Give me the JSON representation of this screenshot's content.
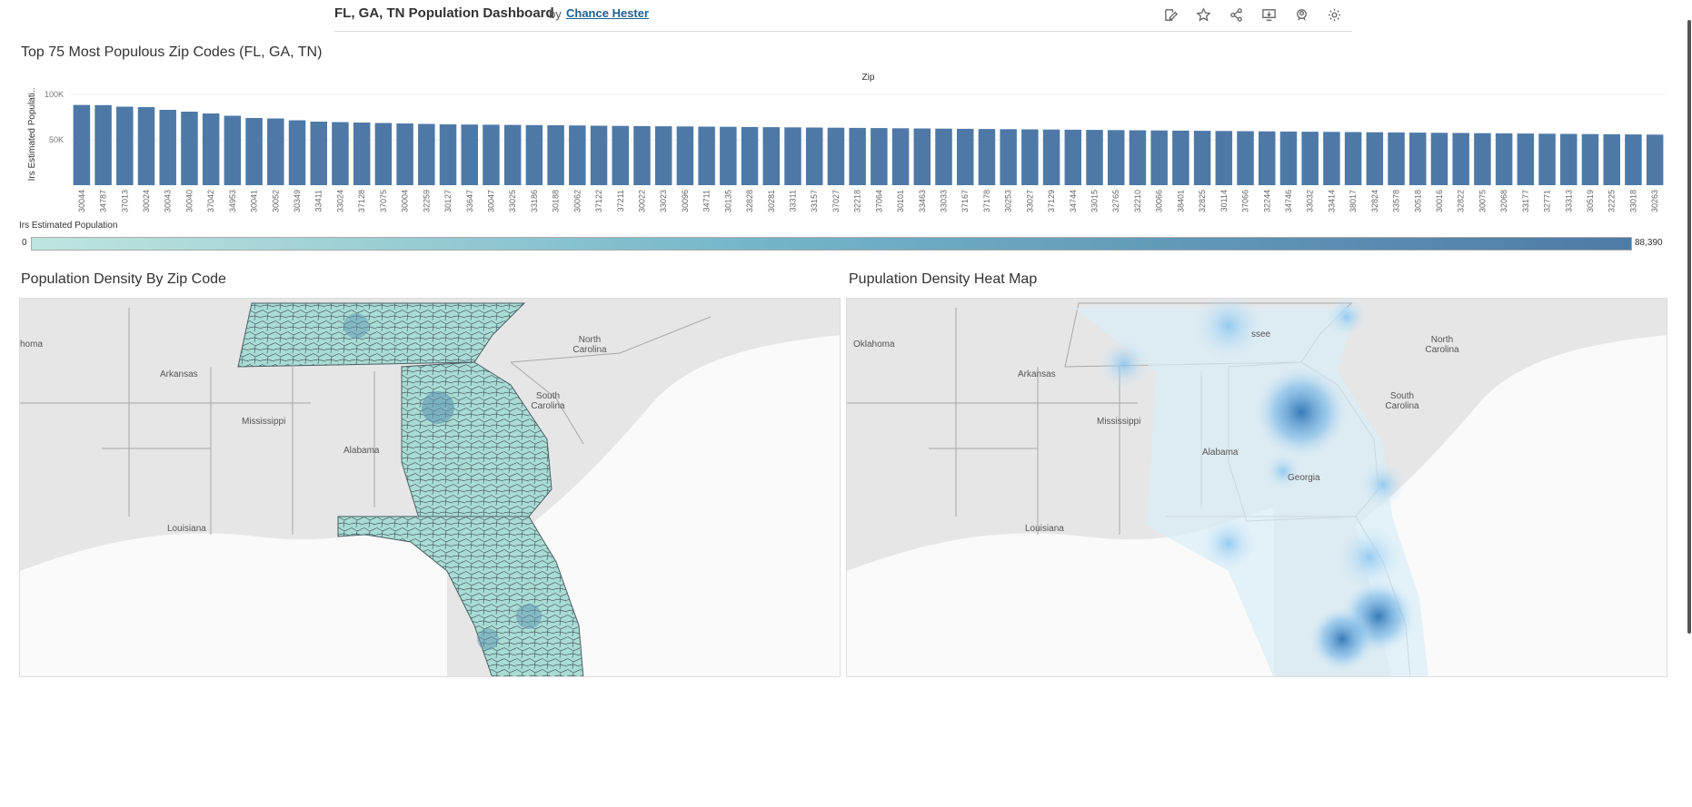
{
  "header": {
    "title": "FL, GA, TN Population Dashboard",
    "by": "by",
    "author": "Chance Hester",
    "toolbar": [
      {
        "icon": "edit-icon"
      },
      {
        "icon": "favorite-star-icon"
      },
      {
        "icon": "share-icon"
      },
      {
        "icon": "download-icon"
      },
      {
        "icon": "watch-icon"
      },
      {
        "icon": "settings-gear-icon"
      }
    ]
  },
  "bar_section": {
    "title": "Top 75 Most Populous Zip Codes (FL, GA, TN)"
  },
  "legend": {
    "title": "Irs Estimated Population",
    "min": "0",
    "max": "88,390",
    "colors": [
      "#bfe5df",
      "#74b6c9",
      "#4e7aa6"
    ]
  },
  "map_left": {
    "title": "Population Density By Zip Code",
    "labels": [
      "homa",
      "Arkansas",
      "Mississippi",
      "Alabama",
      "Louisiana",
      "North Carolina",
      "South Carolina"
    ]
  },
  "map_right": {
    "title": "Pupulation Density Heat Map",
    "labels": [
      "Oklahoma",
      "Arkansas",
      "Mississippi",
      "Alabama",
      "Louisiana",
      "ssee",
      "North Carolina",
      "South Carolina",
      "Georgia"
    ]
  },
  "chart_data": {
    "type": "bar",
    "title": "Top 75 Most Populous Zip Codes (FL, GA, TN)",
    "xlabel": "Zip",
    "ylabel": "Irs Estimated Populati..",
    "y_ticks": [
      "50K",
      "100K"
    ],
    "ylim": [
      0,
      120000
    ],
    "color": "#4e79a7",
    "categories": [
      "30044",
      "34787",
      "37013",
      "30024",
      "30043",
      "30040",
      "37042",
      "34953",
      "30041",
      "30052",
      "30349",
      "33411",
      "33024",
      "37128",
      "37075",
      "30004",
      "32259",
      "30127",
      "33647",
      "30047",
      "33025",
      "33186",
      "30188",
      "30062",
      "37122",
      "37211",
      "30022",
      "33023",
      "30096",
      "34711",
      "30135",
      "32828",
      "30281",
      "33311",
      "33157",
      "37027",
      "32218",
      "37064",
      "30101",
      "33463",
      "33033",
      "37167",
      "37178",
      "30253",
      "33027",
      "37129",
      "34744",
      "33015",
      "32765",
      "32210",
      "30066",
      "38401",
      "32825",
      "30114",
      "37066",
      "32244",
      "34746",
      "33032",
      "33414",
      "38017",
      "32824",
      "33578",
      "30518",
      "30016",
      "32822",
      "30075",
      "32068",
      "33177",
      "32771",
      "33313",
      "30519",
      "32225",
      "33018",
      "30263"
    ],
    "values": [
      88390,
      88200,
      86500,
      86000,
      83000,
      81000,
      79000,
      76500,
      74000,
      73500,
      71500,
      70000,
      69500,
      69000,
      68500,
      68000,
      67500,
      67000,
      66800,
      66600,
      66400,
      66200,
      66000,
      65800,
      65500,
      65300,
      65100,
      64900,
      64700,
      64500,
      64300,
      64100,
      63900,
      63700,
      63500,
      63300,
      63100,
      62900,
      62700,
      62500,
      62300,
      62100,
      61900,
      61700,
      61500,
      61300,
      61100,
      60900,
      60700,
      60500,
      60300,
      60100,
      59900,
      59700,
      59500,
      59300,
      59100,
      58900,
      58700,
      58500,
      58300,
      58100,
      57900,
      57700,
      57500,
      57300,
      57100,
      56900,
      56700,
      56500,
      56300,
      56100,
      55900,
      55700
    ]
  }
}
